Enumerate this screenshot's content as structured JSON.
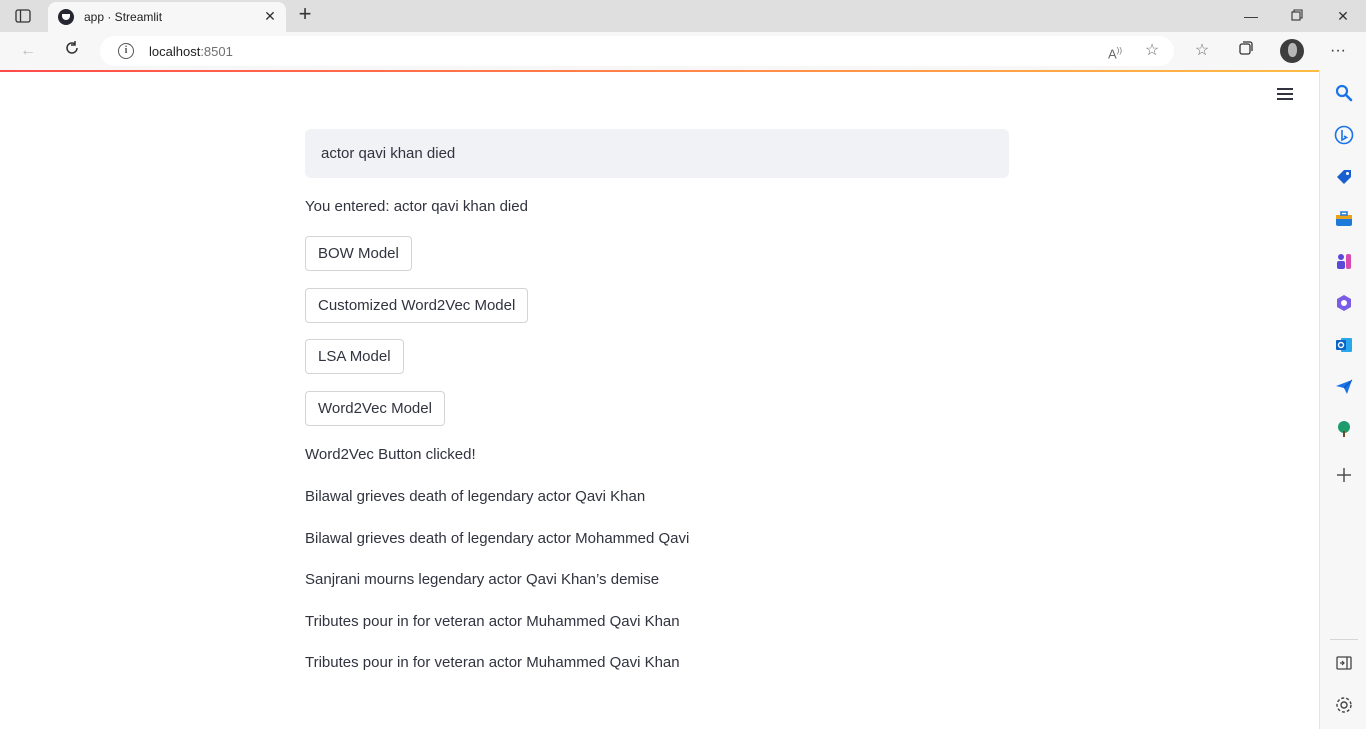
{
  "browser": {
    "tab_title": "app · Streamlit",
    "url_host": "localhost",
    "url_port": ":8501",
    "tab_close_icon": "close-icon",
    "new_tab_icon": "plus-icon"
  },
  "app": {
    "input_value": "actor qavi khan died",
    "entered_text": "You entered: actor qavi khan died",
    "buttons": {
      "bow": "BOW Model",
      "customized_w2v": "Customized Word2Vec Model",
      "lsa": "LSA Model",
      "w2v": "Word2Vec Model"
    },
    "clicked_message": "Word2Vec Button clicked!",
    "results": [
      "Bilawal grieves death of legendary actor Qavi Khan",
      "Bilawal grieves death of legendary actor Mohammed Qavi",
      "Sanjrani mourns legendary actor Qavi Khan’s demise",
      "Tributes pour in for veteran actor Muhammed Qavi Khan",
      "Tributes pour in for veteran actor Muhammed Qavi Khan"
    ]
  },
  "colors": {
    "accent_red": "#ff4b4b",
    "accent_yellow": "#ffbd45",
    "text": "#31333f",
    "input_bg": "#f0f2f6"
  }
}
